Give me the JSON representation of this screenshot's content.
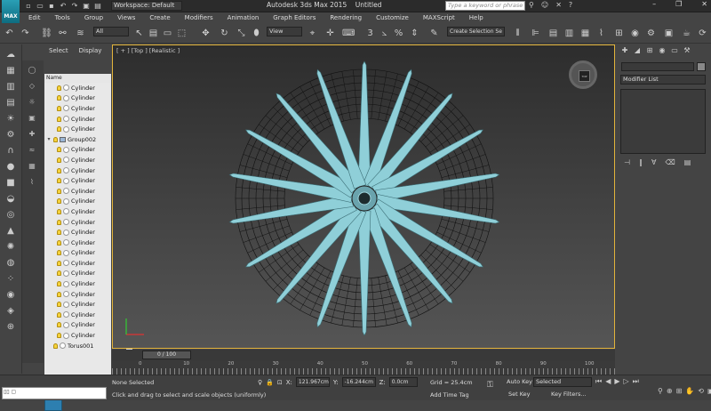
{
  "window": {
    "title": "Autodesk 3ds Max  2015",
    "doc": "Untitled",
    "logo": "MAX"
  },
  "workspace": "Workspace: Default",
  "search_placeholder": "Type a keyword or phrase",
  "menus": [
    "Edit",
    "Tools",
    "Group",
    "Views",
    "Create",
    "Modifiers",
    "Animation",
    "Graph Editors",
    "Rendering",
    "Customize",
    "MAXScript",
    "Help"
  ],
  "toolbar": {
    "selection_filter": "All",
    "ref_coord": "View",
    "named_selection": "Create Selection Se"
  },
  "scene_explorer": {
    "tab_select": "Select",
    "tab_display": "Display",
    "column_name": "Name",
    "items": [
      {
        "label": "Cylinder",
        "indent": 2,
        "kind": "obj"
      },
      {
        "label": "Cylinder",
        "indent": 2,
        "kind": "obj"
      },
      {
        "label": "Cylinder",
        "indent": 2,
        "kind": "obj"
      },
      {
        "label": "Cylinder",
        "indent": 2,
        "kind": "obj"
      },
      {
        "label": "Cylinder",
        "indent": 2,
        "kind": "obj"
      },
      {
        "label": "Group002",
        "indent": 1,
        "kind": "group"
      },
      {
        "label": "Cylinder",
        "indent": 2,
        "kind": "obj"
      },
      {
        "label": "Cylinder",
        "indent": 2,
        "kind": "obj"
      },
      {
        "label": "Cylinder",
        "indent": 2,
        "kind": "obj"
      },
      {
        "label": "Cylinder",
        "indent": 2,
        "kind": "obj"
      },
      {
        "label": "Cylinder",
        "indent": 2,
        "kind": "obj"
      },
      {
        "label": "Cylinder",
        "indent": 2,
        "kind": "obj"
      },
      {
        "label": "Cylinder",
        "indent": 2,
        "kind": "obj"
      },
      {
        "label": "Cylinder",
        "indent": 2,
        "kind": "obj"
      },
      {
        "label": "Cylinder",
        "indent": 2,
        "kind": "obj"
      },
      {
        "label": "Cylinder",
        "indent": 2,
        "kind": "obj"
      },
      {
        "label": "Cylinder",
        "indent": 2,
        "kind": "obj"
      },
      {
        "label": "Cylinder",
        "indent": 2,
        "kind": "obj"
      },
      {
        "label": "Cylinder",
        "indent": 2,
        "kind": "obj"
      },
      {
        "label": "Cylinder",
        "indent": 2,
        "kind": "obj"
      },
      {
        "label": "Cylinder",
        "indent": 2,
        "kind": "obj"
      },
      {
        "label": "Cylinder",
        "indent": 2,
        "kind": "obj"
      },
      {
        "label": "Cylinder",
        "indent": 2,
        "kind": "obj"
      },
      {
        "label": "Cylinder",
        "indent": 2,
        "kind": "obj"
      },
      {
        "label": "Cylinder",
        "indent": 2,
        "kind": "obj"
      },
      {
        "label": "Torus001",
        "indent": 1,
        "kind": "obj"
      }
    ]
  },
  "viewport": {
    "label": "[ + ] [Top ] [Realistic ]",
    "cube_face": "TOP"
  },
  "command_panel": {
    "modifier_list": "Modifier List"
  },
  "timeline": {
    "slider": "0 / 100",
    "ticks": [
      "0",
      "10",
      "20",
      "30",
      "40",
      "50",
      "60",
      "70",
      "80",
      "90",
      "100"
    ]
  },
  "status": {
    "selection": "None Selected",
    "prompt": "Click and drag to select and scale objects (uniformly)",
    "x_label": "X:",
    "x": "121.967cm",
    "y_label": "Y:",
    "y": "-16.244cm",
    "z_label": "Z:",
    "z": "0.0cm",
    "grid": "Grid = 25.4cm",
    "add_time_tag": "Add Time Tag",
    "auto_key": "Auto Key",
    "set_key": "Set Key",
    "key_mode": "Selected",
    "key_filters": "Key Filters..."
  },
  "colors": {
    "accent": "#e3b43b",
    "model": "#8fcfd8",
    "viewport_top": "#2d2d2d"
  }
}
